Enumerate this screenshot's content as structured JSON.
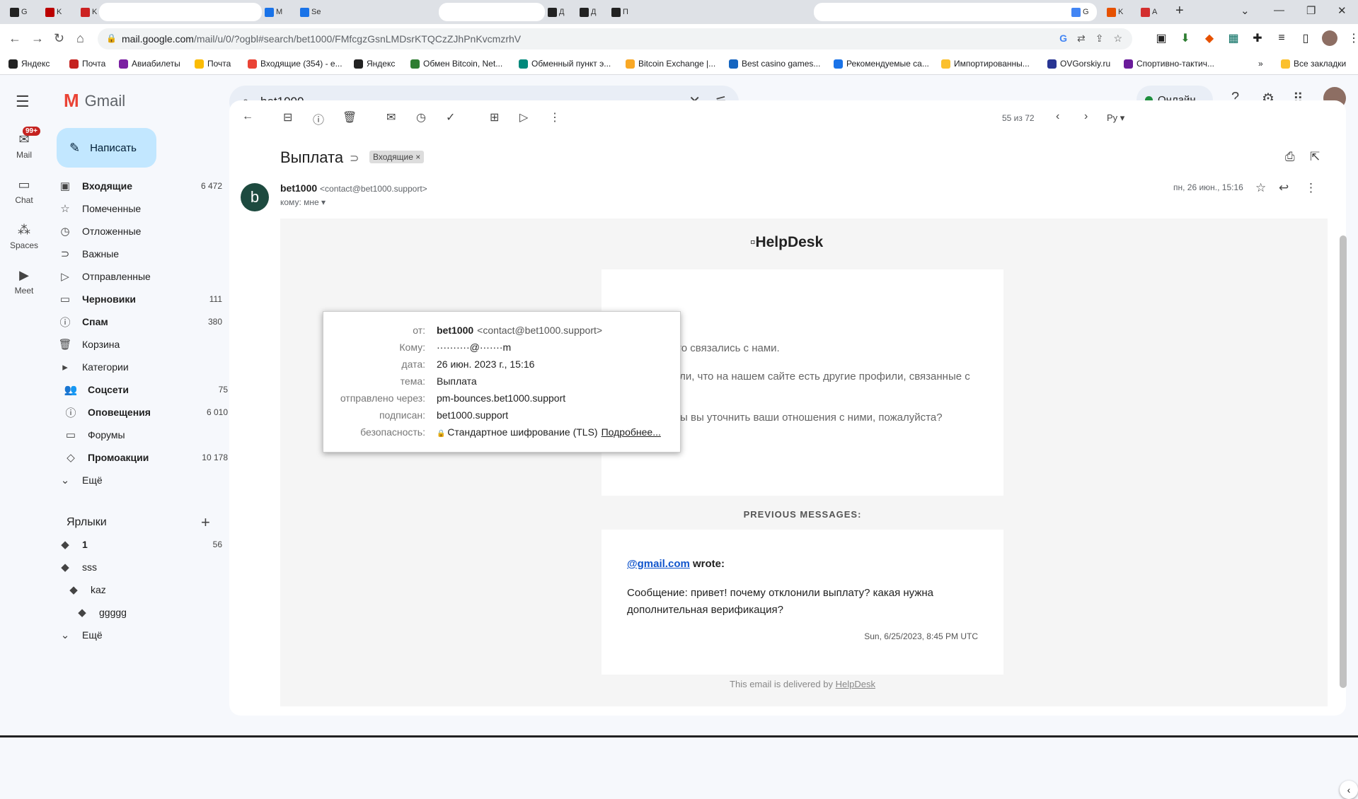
{
  "browser": {
    "tabs": [
      {
        "label": "G",
        "color": "#222"
      },
      {
        "label": "K",
        "color": "#b00"
      },
      {
        "label": "K",
        "color": "#c22"
      },
      {
        "label": "M",
        "color": "#1a73e8"
      },
      {
        "label": "Se",
        "color": "#1a73e8"
      },
      {
        "label": "Д",
        "color": "#222"
      },
      {
        "label": "Д",
        "color": "#222"
      },
      {
        "label": "П",
        "color": "#222"
      },
      {
        "label": "G",
        "color": "#4285f4"
      },
      {
        "label": "K",
        "color": "#e65100"
      },
      {
        "label": "A",
        "color": "#d32f2f"
      }
    ],
    "url_host": "mail.google.com",
    "url_path": "/mail/u/0/?ogbl#search/bet1000/FMfcgzGsnLMDsrKTQCzZJhPnKvcmzrhV",
    "bookmarks": [
      {
        "label": "Яндекс",
        "color": "#222"
      },
      {
        "label": "Почта",
        "color": "#c5221f"
      },
      {
        "label": "Авиабилеты",
        "color": "#7b1fa2"
      },
      {
        "label": "Почта",
        "color": "#fbbc04"
      },
      {
        "label": "Входящие (354) - e...",
        "color": "#ea4335"
      },
      {
        "label": "Яндекс",
        "color": "#222"
      },
      {
        "label": "Обмен Bitcoin, Net...",
        "color": "#2e7d32"
      },
      {
        "label": "Обменный пункт э...",
        "color": "#00897b"
      },
      {
        "label": "Bitcoin Exchange |...",
        "color": "#f9a825"
      },
      {
        "label": "Best casino games...",
        "color": "#1565c0"
      },
      {
        "label": "Рекомендуемые са...",
        "color": "#1a73e8"
      },
      {
        "label": "Импортированны...",
        "color": "#fbc02d"
      },
      {
        "label": "OVGorskiy.ru",
        "color": "#283593"
      },
      {
        "label": "Спортивно-тактич...",
        "color": "#6a1b9a"
      }
    ],
    "bookmarks_more": "»",
    "all_bookmarks": "Все закладки"
  },
  "gmail": {
    "logo_text": "Gmail",
    "search_query": "bet1000",
    "status": "Онлайн",
    "rail": [
      {
        "label": "Mail",
        "badge": "99+"
      },
      {
        "label": "Chat"
      },
      {
        "label": "Spaces"
      },
      {
        "label": "Meet"
      }
    ],
    "compose": "Написать",
    "nav": [
      {
        "label": "Входящие",
        "count": "6 472",
        "bold": true,
        "icon": "▣"
      },
      {
        "label": "Помеченные",
        "count": "",
        "bold": false,
        "icon": "☆"
      },
      {
        "label": "Отложенные",
        "count": "",
        "bold": false,
        "icon": "◷"
      },
      {
        "label": "Важные",
        "count": "",
        "bold": false,
        "icon": "⊃"
      },
      {
        "label": "Отправленные",
        "count": "",
        "bold": false,
        "icon": "▷"
      },
      {
        "label": "Черновики",
        "count": "111",
        "bold": true,
        "icon": "▭"
      },
      {
        "label": "Спам",
        "count": "380",
        "bold": true,
        "icon": "ⓘ"
      },
      {
        "label": "Корзина",
        "count": "",
        "bold": false,
        "icon": "🗑"
      },
      {
        "label": "Категории",
        "count": "",
        "bold": false,
        "icon": "▸"
      },
      {
        "label": "Соцсети",
        "count": "75",
        "bold": true,
        "icon": "👥",
        "indent": true
      },
      {
        "label": "Оповещения",
        "count": "6 010",
        "bold": true,
        "icon": "ⓘ",
        "indent": true
      },
      {
        "label": "Форумы",
        "count": "",
        "bold": false,
        "icon": "▭",
        "indent": true
      },
      {
        "label": "Промоакции",
        "count": "10 178",
        "bold": true,
        "icon": "◇",
        "indent": true
      },
      {
        "label": "Ещё",
        "count": "",
        "bold": false,
        "icon": "⌄"
      }
    ],
    "labels_header": "Ярлыки",
    "labels": [
      {
        "label": "1",
        "count": "56",
        "bold": true,
        "level": 0
      },
      {
        "label": "sss",
        "count": "",
        "bold": false,
        "level": 0
      },
      {
        "label": "kaz",
        "count": "",
        "bold": false,
        "level": 1
      },
      {
        "label": "ggggg",
        "count": "",
        "bold": false,
        "level": 2
      },
      {
        "label": "Ещё",
        "count": "",
        "bold": false,
        "level": 0
      }
    ],
    "pager": "55 из 72",
    "lang": "Ру",
    "subject": "Выплата",
    "subject_chip": "Входящие",
    "sender_initial": "b",
    "sender_name": "bet1000",
    "sender_email": "<contact@bet1000.support>",
    "to_line": "кому: мне",
    "date": "пн, 26 июн., 15:16",
    "popup": [
      {
        "key": "от:",
        "value": "bet1000",
        "extra": "<contact@bet1000.support>"
      },
      {
        "key": "Кому:",
        "value": "··········@·······m"
      },
      {
        "key": "дата:",
        "value": "26 июн. 2023 г., 15:16"
      },
      {
        "key": "тема:",
        "value": "Выплата"
      },
      {
        "key": "отправлено через:",
        "value": "pm-bounces.bet1000.support"
      },
      {
        "key": "подписан:",
        "value": "bet1000.support"
      },
      {
        "key": "безопасность:",
        "value": "Стандартное шифрование (TLS)",
        "link": "Подробнее..."
      }
    ],
    "body": {
      "header_alt": "HelpDesk",
      "p1": "Спасибо что связались с нами.",
      "p2": "Мы заметили, что на нашем сайте есть другие профили, связанные с вашим.",
      "p3": "Не могли бы вы уточнить ваши отношения с ними, пожалуйста?",
      "previous": "PREVIOUS MESSAGES:",
      "wrote_email": "@gmail.com",
      "wrote_suffix": " wrote:",
      "prev_msg": "Сообщение: привет! почему отклонили выплату? какая нужна дополнительная верификация?",
      "prev_ts": "Sun, 6/25/2023, 8:45 PM UTC",
      "footer_prefix": "This email is delivered by ",
      "footer_link": "HelpDesk"
    }
  }
}
